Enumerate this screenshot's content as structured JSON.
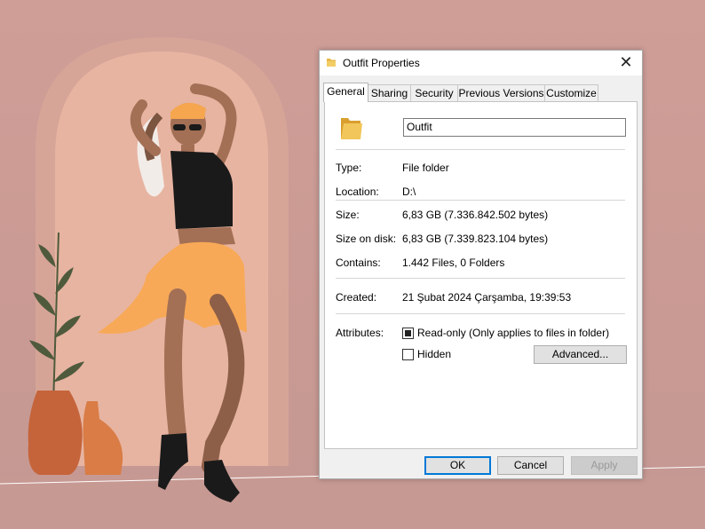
{
  "dialog": {
    "title": "Outfit Properties",
    "close_glyph": "✕",
    "tabs": [
      {
        "label": "General",
        "active": true
      },
      {
        "label": "Sharing"
      },
      {
        "label": "Security"
      },
      {
        "label": "Previous Versions"
      },
      {
        "label": "Customize"
      }
    ],
    "folder_name": "Outfit",
    "properties": {
      "type_label": "Type:",
      "type_value": "File folder",
      "location_label": "Location:",
      "location_value": "D:\\",
      "size_label": "Size:",
      "size_value": "6,83 GB (7.336.842.502 bytes)",
      "size_on_disk_label": "Size on disk:",
      "size_on_disk_value": "6,83 GB (7.339.823.104 bytes)",
      "contains_label": "Contains:",
      "contains_value": "1.442 Files, 0 Folders",
      "created_label": "Created:",
      "created_value": "21 Şubat 2024 Çarşamba, 19:39:53",
      "attributes_label": "Attributes:"
    },
    "attributes": {
      "readonly_label": "Read-only (Only applies to files in folder)",
      "readonly_state": "indeterminate",
      "hidden_label": "Hidden",
      "hidden_checked": false,
      "advanced_label": "Advanced..."
    },
    "buttons": {
      "ok": "OK",
      "cancel": "Cancel",
      "apply": "Apply"
    }
  },
  "colors": {
    "background": "#cf9e97",
    "arch": "#e2ad9b",
    "skirt": "#f8a957",
    "vase": "#c5643b",
    "accent": "#0078d7",
    "folder": "#e8b84a"
  },
  "icons": {
    "folder": "folder-icon",
    "close": "close-icon"
  }
}
